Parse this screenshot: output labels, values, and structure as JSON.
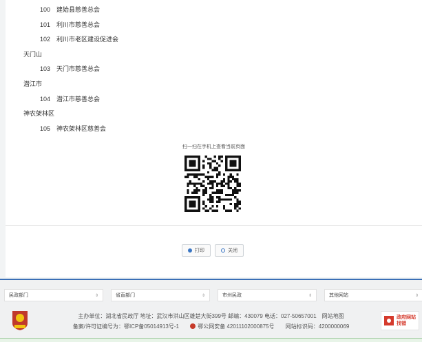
{
  "list": [
    {
      "type": "item",
      "num": "100",
      "name": "建始县慈善总会"
    },
    {
      "type": "item",
      "num": "101",
      "name": "利川市慈善总会"
    },
    {
      "type": "item",
      "num": "102",
      "name": "利川市老区建设促进会"
    },
    {
      "type": "region",
      "name": "天门山"
    },
    {
      "type": "item",
      "num": "103",
      "name": "天门市慈善总会"
    },
    {
      "type": "region",
      "name": "潜江市"
    },
    {
      "type": "item",
      "num": "104",
      "name": "潜江市慈善总会"
    },
    {
      "type": "region",
      "name": "神农架林区"
    },
    {
      "type": "item",
      "num": "105",
      "name": "神农架林区慈善会"
    }
  ],
  "qr": {
    "label": "扫一扫在手机上查看当前页面"
  },
  "buttons": {
    "print": "打印",
    "close": "关闭"
  },
  "footer": {
    "selects": [
      "民政部门",
      "省直部门",
      "市州民政",
      "其他网站"
    ],
    "host": "主办单位：湖北省民政厅 地址：武汉市洪山区雄楚大街399号 邮编：430079 电话：027-50657001",
    "sitemap": "网站地图",
    "icp": "备案/许可证编号为：鄂ICP备05014913号-1",
    "police": "鄂公网安备 42011102000875号",
    "site_id": "网站标识码：4200000069",
    "badge_line1": "政府网站",
    "badge_line2": "找错"
  },
  "colors": {
    "accent": "#3a6fb6",
    "badge": "#d53a2c"
  }
}
